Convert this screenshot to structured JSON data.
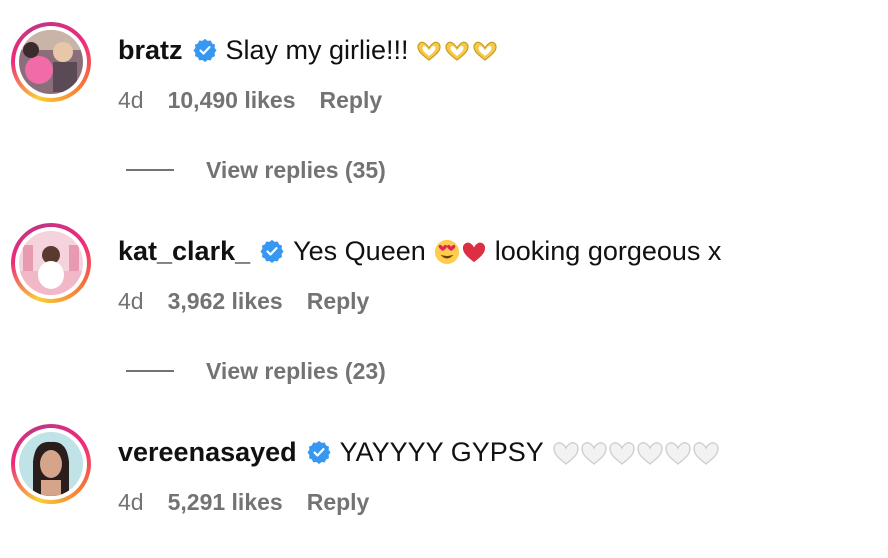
{
  "comments": [
    {
      "username": "bratz",
      "text": "Slay my girlie!!!",
      "emoji": [
        "heart-hands-emoji",
        "heart-hands-emoji",
        "heart-hands-emoji"
      ],
      "time": "4d",
      "likes": "10,490 likes",
      "reply_label": "Reply",
      "view_replies": "View replies (35)"
    },
    {
      "username": "kat_clark_",
      "text": "Yes Queen",
      "text_after": "looking gorgeous x",
      "emoji": [
        "heart-eyes-emoji",
        "red-heart-emoji"
      ],
      "time": "4d",
      "likes": "3,962 likes",
      "reply_label": "Reply",
      "view_replies": "View replies (23)"
    },
    {
      "username": "vereenasayed",
      "text": "YAYYYY GYPSY",
      "emoji": [
        "white-heart-emoji",
        "white-heart-emoji",
        "white-heart-emoji",
        "white-heart-emoji",
        "white-heart-emoji",
        "white-heart-emoji"
      ],
      "time": "4d",
      "likes": "5,291 likes",
      "reply_label": "Reply"
    }
  ],
  "colors": {
    "verified_badge": "#3897f0",
    "secondary_text": "#737373",
    "primary_text": "#111111"
  }
}
